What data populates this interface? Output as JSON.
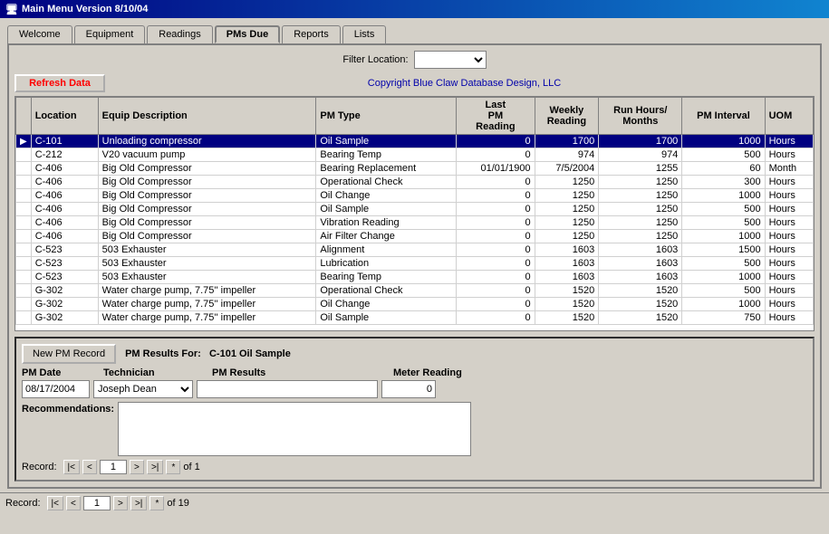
{
  "titleBar": {
    "text": "Main Menu Version 8/10/04"
  },
  "tabs": [
    {
      "label": "Welcome",
      "active": false
    },
    {
      "label": "Equipment",
      "active": false
    },
    {
      "label": "Readings",
      "active": false
    },
    {
      "label": "PMs Due",
      "active": true
    },
    {
      "label": "Reports",
      "active": false
    },
    {
      "label": "Lists",
      "active": false
    }
  ],
  "filterLocation": {
    "label": "Filter Location:",
    "value": ""
  },
  "toolbar": {
    "refreshLabel": "Refresh Data",
    "copyright": "Copyright Blue Claw Database Design, LLC"
  },
  "gridHeaders": [
    {
      "key": "arrow",
      "label": ""
    },
    {
      "key": "location",
      "label": "Location"
    },
    {
      "key": "equipDesc",
      "label": "Equip Description"
    },
    {
      "key": "pmType",
      "label": "PM Type"
    },
    {
      "key": "lastPM",
      "label": "Last PM Reading"
    },
    {
      "key": "weekly",
      "label": "Weekly Reading"
    },
    {
      "key": "runHours",
      "label": "Run Hours/ Months"
    },
    {
      "key": "pmInterval",
      "label": "PM Interval"
    },
    {
      "key": "uom",
      "label": "UOM"
    }
  ],
  "gridRows": [
    {
      "selected": true,
      "location": "C-101",
      "equipDesc": "Unloading compressor",
      "pmType": "Oil Sample",
      "lastPM": "0",
      "weekly": "1700",
      "runHours": "1700",
      "pmInterval": "1000",
      "uom": "Hours"
    },
    {
      "selected": false,
      "location": "C-212",
      "equipDesc": "V20 vacuum pump",
      "pmType": "Bearing Temp",
      "lastPM": "0",
      "weekly": "974",
      "runHours": "974",
      "pmInterval": "500",
      "uom": "Hours"
    },
    {
      "selected": false,
      "location": "C-406",
      "equipDesc": "Big Old Compressor",
      "pmType": "Bearing Replacement",
      "lastPM": "01/01/1900",
      "weekly": "7/5/2004",
      "runHours": "1255",
      "pmInterval": "60",
      "uom": "Month"
    },
    {
      "selected": false,
      "location": "C-406",
      "equipDesc": "Big Old Compressor",
      "pmType": "Operational Check",
      "lastPM": "0",
      "weekly": "1250",
      "runHours": "1250",
      "pmInterval": "300",
      "uom": "Hours"
    },
    {
      "selected": false,
      "location": "C-406",
      "equipDesc": "Big Old Compressor",
      "pmType": "Oil Change",
      "lastPM": "0",
      "weekly": "1250",
      "runHours": "1250",
      "pmInterval": "1000",
      "uom": "Hours"
    },
    {
      "selected": false,
      "location": "C-406",
      "equipDesc": "Big Old Compressor",
      "pmType": "Oil Sample",
      "lastPM": "0",
      "weekly": "1250",
      "runHours": "1250",
      "pmInterval": "500",
      "uom": "Hours"
    },
    {
      "selected": false,
      "location": "C-406",
      "equipDesc": "Big Old Compressor",
      "pmType": "Vibration Reading",
      "lastPM": "0",
      "weekly": "1250",
      "runHours": "1250",
      "pmInterval": "500",
      "uom": "Hours"
    },
    {
      "selected": false,
      "location": "C-406",
      "equipDesc": "Big Old Compressor",
      "pmType": "Air Filter Change",
      "lastPM": "0",
      "weekly": "1250",
      "runHours": "1250",
      "pmInterval": "1000",
      "uom": "Hours"
    },
    {
      "selected": false,
      "location": "C-523",
      "equipDesc": "503 Exhauster",
      "pmType": "Alignment",
      "lastPM": "0",
      "weekly": "1603",
      "runHours": "1603",
      "pmInterval": "1500",
      "uom": "Hours"
    },
    {
      "selected": false,
      "location": "C-523",
      "equipDesc": "503 Exhauster",
      "pmType": "Lubrication",
      "lastPM": "0",
      "weekly": "1603",
      "runHours": "1603",
      "pmInterval": "500",
      "uom": "Hours"
    },
    {
      "selected": false,
      "location": "C-523",
      "equipDesc": "503 Exhauster",
      "pmType": "Bearing Temp",
      "lastPM": "0",
      "weekly": "1603",
      "runHours": "1603",
      "pmInterval": "1000",
      "uom": "Hours"
    },
    {
      "selected": false,
      "location": "G-302",
      "equipDesc": "Water charge pump, 7.75'' impeller",
      "pmType": "Operational Check",
      "lastPM": "0",
      "weekly": "1520",
      "runHours": "1520",
      "pmInterval": "500",
      "uom": "Hours"
    },
    {
      "selected": false,
      "location": "G-302",
      "equipDesc": "Water charge pump, 7.75'' impeller",
      "pmType": "Oil Change",
      "lastPM": "0",
      "weekly": "1520",
      "runHours": "1520",
      "pmInterval": "1000",
      "uom": "Hours"
    },
    {
      "selected": false,
      "location": "G-302",
      "equipDesc": "Water charge pump, 7.75'' impeller",
      "pmType": "Oil Sample",
      "lastPM": "0",
      "weekly": "1520",
      "runHours": "1520",
      "pmInterval": "750",
      "uom": "Hours"
    }
  ],
  "pmSection": {
    "newRecordLabel": "New PM Record",
    "resultsForLabel": "PM Results For:",
    "resultsForValue": "C-101 Oil Sample",
    "colHeaders": {
      "date": "PM Date",
      "tech": "Technician",
      "results": "PM Results",
      "meter": "Meter Reading"
    },
    "dateValue": "08/17/2004",
    "techValue": "Joseph Dean",
    "meterValue": "0",
    "recLabel": "Recommendations:",
    "navRecord": {
      "label": "Record:",
      "first": "|<",
      "prev": "<",
      "current": "1",
      "next": ">",
      "last": ">|",
      "new": "*",
      "ofLabel": "of 1"
    }
  },
  "outerNav": {
    "label": "Record:",
    "first": "|<",
    "prev": "<",
    "current": "1",
    "next": ">",
    "last": ">|",
    "new": "*",
    "ofLabel": "of 19"
  }
}
